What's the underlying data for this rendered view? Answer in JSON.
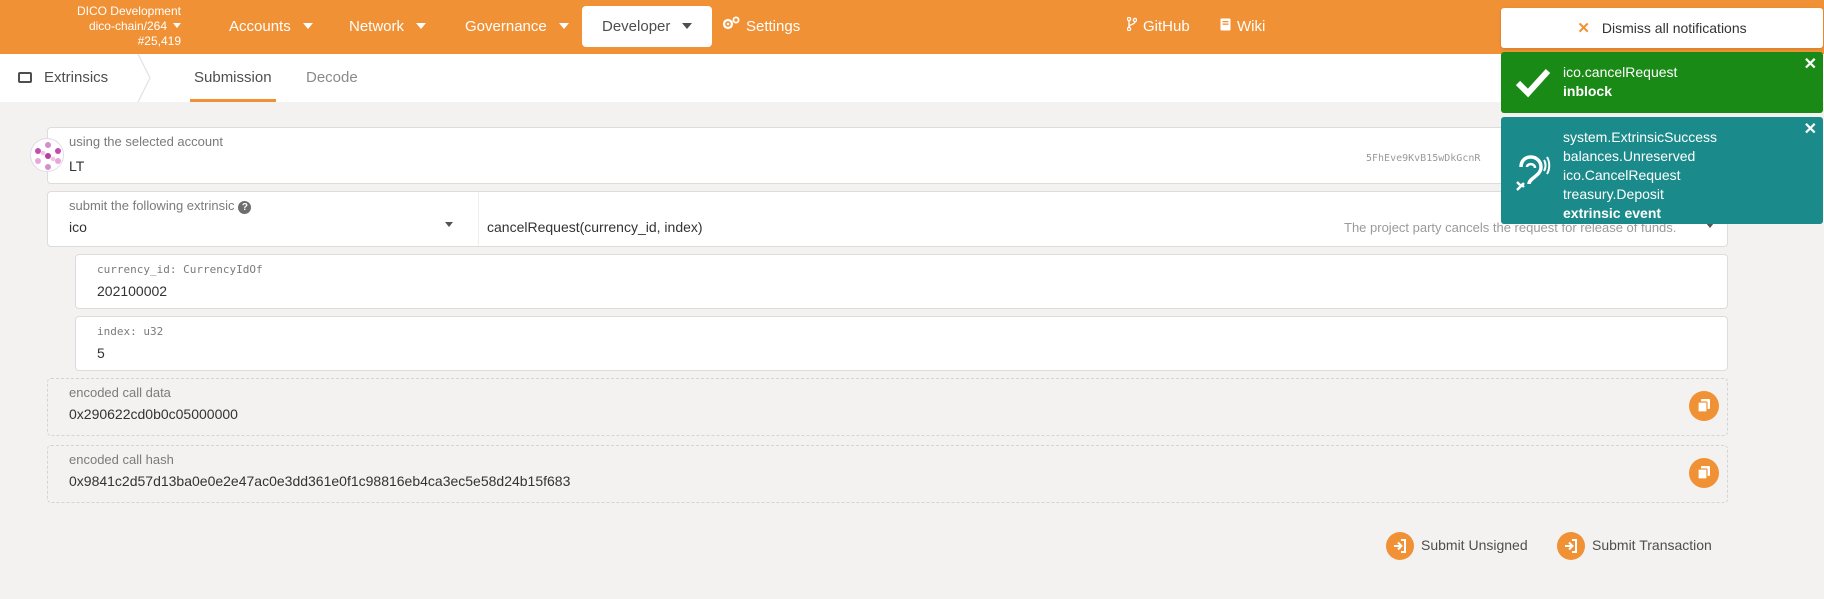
{
  "colors": {
    "brand": "#f19135",
    "success": "#1a8a16",
    "event": "#1b8a8a"
  },
  "header": {
    "chain_name": "DICO Development",
    "chain_spec": "dico-chain/264",
    "block": "#25,419",
    "menu": [
      {
        "label": "Accounts",
        "icon": "caret-down-icon"
      },
      {
        "label": "Network",
        "icon": "caret-down-icon"
      },
      {
        "label": "Governance",
        "icon": "caret-down-icon"
      },
      {
        "label": "Developer",
        "icon": "caret-down-icon",
        "active": true
      },
      {
        "label": "Settings",
        "icon": "gears-icon"
      }
    ],
    "links": [
      {
        "label": "GitHub",
        "icon": "code-branch-icon"
      },
      {
        "label": "Wiki",
        "icon": "book-icon"
      }
    ]
  },
  "tabs": {
    "section": "Extrinsics",
    "items": [
      {
        "label": "Submission",
        "active": true
      },
      {
        "label": "Decode"
      }
    ]
  },
  "form": {
    "account_label": "using the selected account",
    "account_name": "LT",
    "account_address": "5FhEve9KvB15wDkGcnR",
    "extrinsic_label": "submit the following extrinsic",
    "pallet": "ico",
    "method": "cancelRequest(currency_id, index)",
    "method_description": "The project party cancels the request for release of funds.",
    "params": [
      {
        "label": "currency_id: CurrencyIdOf",
        "value": "202100002"
      },
      {
        "label": "index: u32",
        "value": "5"
      }
    ],
    "call_data_label": "encoded call data",
    "call_data": "0x290622cd0b0c05000000",
    "call_hash_label": "encoded call hash",
    "call_hash": "0x9841c2d57d13ba0e0e2e47ac0e3dd361e0f1c98816eb4ca3ec5e58d24b15f683"
  },
  "actions": {
    "submit_unsigned": "Submit Unsigned",
    "submit_transaction": "Submit Transaction"
  },
  "notifications": {
    "dismiss_all": "Dismiss all notifications",
    "items": [
      {
        "icon": "check-icon",
        "lines": [
          "ico.cancelRequest"
        ],
        "status": "inblock"
      },
      {
        "icon": "assistive-listening-icon",
        "lines": [
          "system.ExtrinsicSuccess",
          "balances.Unreserved",
          "ico.CancelRequest",
          "treasury.Deposit"
        ],
        "status": "extrinsic event"
      }
    ]
  }
}
